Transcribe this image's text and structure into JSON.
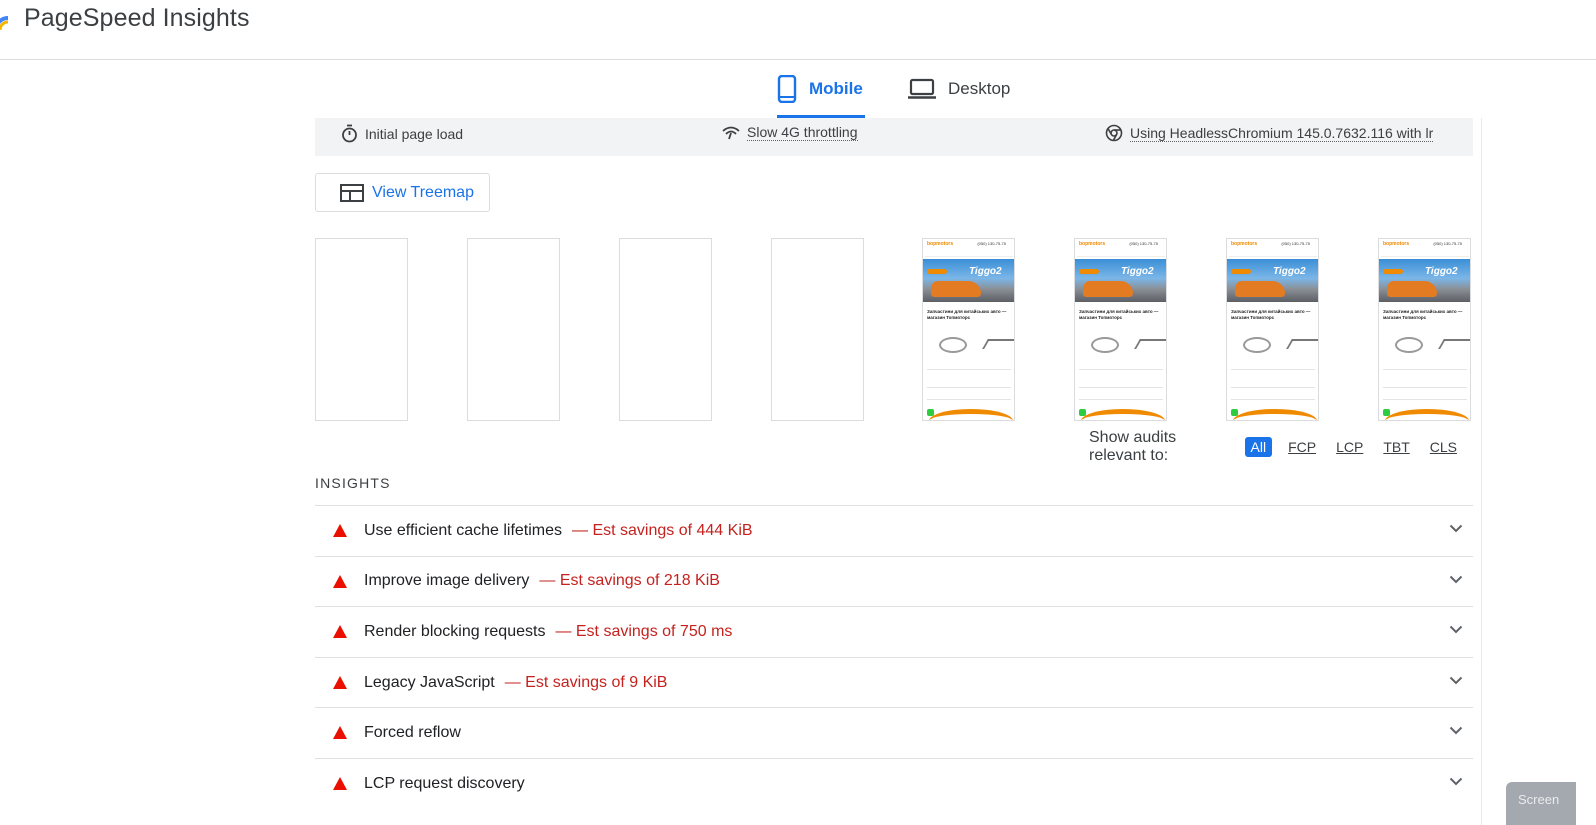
{
  "app": {
    "title": "PageSpeed Insights"
  },
  "tabs": [
    {
      "label": "Mobile",
      "icon": "smartphone-icon",
      "active": true
    },
    {
      "label": "Desktop",
      "icon": "laptop-icon",
      "active": false
    }
  ],
  "environment": {
    "load": "Initial page load",
    "throttling": "Slow 4G throttling",
    "browser": "Using HeadlessChromium 145.0.7632.116 with lr"
  },
  "treemap": {
    "label": "View Treemap"
  },
  "filmstrip": {
    "blank_frames": 4,
    "loaded_frames": 4,
    "brand": "bopmotors",
    "phone": "(050) 130-75-75",
    "hero_word": "Tiggo2",
    "caption": "Запчастини для китайських авто — магазин Топмоторс"
  },
  "filter": {
    "label": "Show audits relevant to:",
    "options": [
      "All",
      "FCP",
      "LCP",
      "TBT",
      "CLS"
    ],
    "active": "All"
  },
  "insights": {
    "section_title": "INSIGHTS",
    "items": [
      {
        "title": "Use efficient cache lifetimes",
        "savings": "— Est savings of 444 KiB"
      },
      {
        "title": "Improve image delivery",
        "savings": "— Est savings of 218 KiB"
      },
      {
        "title": "Render blocking requests",
        "savings": "— Est savings of 750 ms"
      },
      {
        "title": "Legacy JavaScript",
        "savings": "— Est savings of 9 KiB"
      },
      {
        "title": "Forced reflow",
        "savings": ""
      },
      {
        "title": "LCP request discovery",
        "savings": ""
      }
    ]
  },
  "overlay": {
    "label": "Screen"
  },
  "colors": {
    "accent": "#1a73e8",
    "fail": "#eb0f00",
    "savings": "#c5221f"
  }
}
